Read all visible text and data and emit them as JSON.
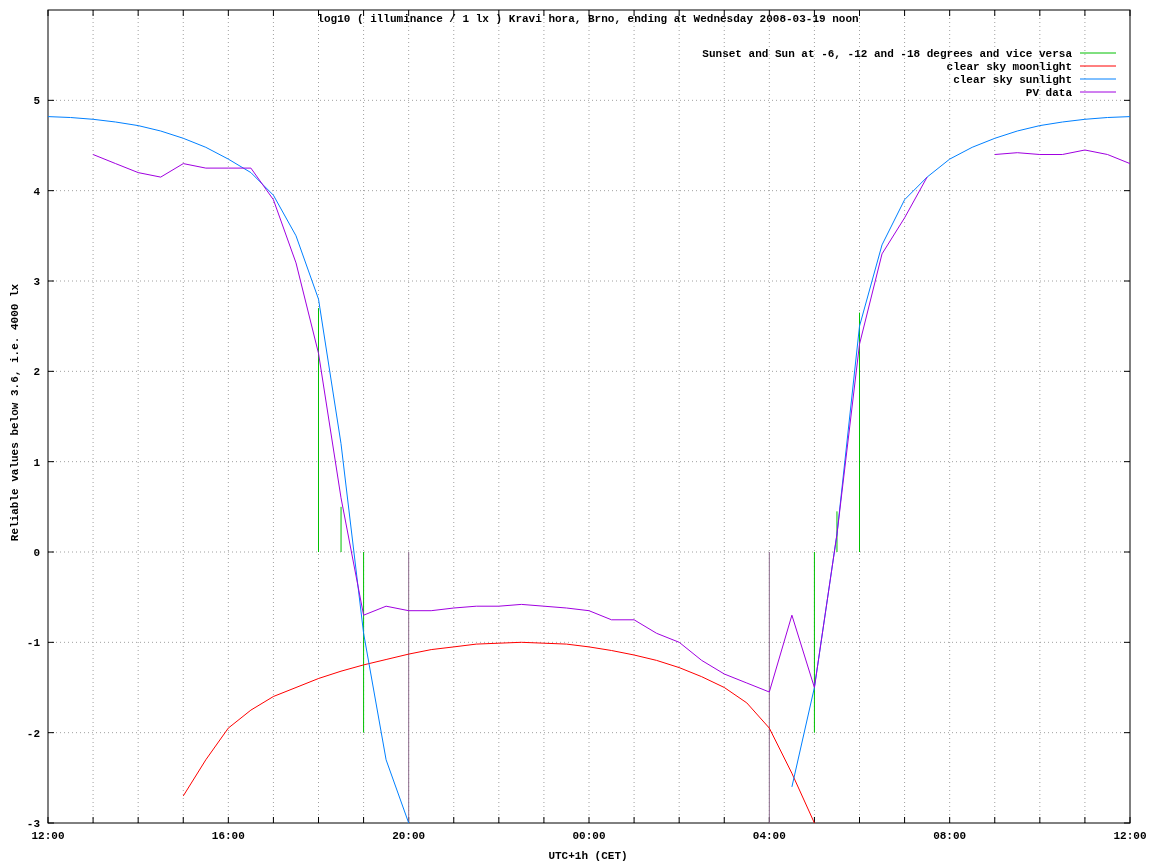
{
  "chart_data": {
    "type": "line",
    "title": "log10 ( illuminance / 1 lx ) Kravi hora, Brno, ending at Wednesday 2008-03-19 noon",
    "xlabel": "UTC+1h (CET)",
    "ylabel": "Reliable values below 3.6, i.e. 4000 lx",
    "ylim": [
      -3,
      6
    ],
    "categories": [
      "12:00",
      null,
      null,
      null,
      null,
      null,
      null,
      null,
      "16:00",
      null,
      null,
      null,
      null,
      null,
      null,
      null,
      "20:00",
      null,
      null,
      null,
      null,
      null,
      null,
      null,
      "00:00",
      null,
      null,
      null,
      null,
      null,
      null,
      null,
      "04:00",
      null,
      null,
      null,
      null,
      null,
      null,
      null,
      "08:00",
      null,
      null,
      null,
      null,
      null,
      null,
      null,
      "12:00"
    ],
    "yticks": [
      -3,
      -2,
      -1,
      0,
      1,
      2,
      3,
      4,
      5
    ],
    "grid": true,
    "legend": "upper right",
    "series": [
      {
        "name": "Sunset and Sun at -6, -12 and -18 degrees and vice versa",
        "color": "#00c000",
        "type": "bar",
        "values": [
          null,
          null,
          null,
          null,
          null,
          null,
          null,
          null,
          null,
          null,
          null,
          null,
          2.7,
          0.5,
          -2.0,
          null,
          null,
          null,
          null,
          null,
          null,
          null,
          null,
          null,
          null,
          null,
          null,
          null,
          null,
          null,
          null,
          null,
          null,
          null,
          -2.0,
          0.45,
          2.65,
          null,
          null,
          null,
          null,
          null,
          null,
          null,
          null,
          null,
          null,
          null,
          null
        ]
      },
      {
        "color": "#8c6c8c",
        "type": "bar",
        "values": [
          null,
          null,
          null,
          null,
          null,
          null,
          null,
          null,
          null,
          null,
          null,
          null,
          null,
          null,
          null,
          null,
          -3.0,
          null,
          null,
          null,
          null,
          null,
          null,
          null,
          null,
          null,
          null,
          null,
          null,
          null,
          null,
          null,
          -3.0,
          null,
          null,
          null,
          null,
          null,
          null,
          null,
          null,
          null,
          null,
          null,
          null,
          null,
          null,
          null,
          null
        ]
      },
      {
        "name": "clear sky moonlight",
        "color": "#ff0000",
        "values": [
          null,
          null,
          null,
          null,
          null,
          null,
          -2.7,
          -2.3,
          -1.95,
          -1.75,
          -1.6,
          -1.5,
          -1.4,
          -1.32,
          -1.25,
          -1.19,
          -1.13,
          -1.08,
          -1.05,
          -1.02,
          -1.01,
          -1.0,
          -1.01,
          -1.02,
          -1.05,
          -1.09,
          -1.14,
          -1.2,
          -1.28,
          -1.38,
          -1.5,
          -1.67,
          -1.95,
          -2.45,
          -3.0,
          null,
          null,
          null,
          null,
          null,
          null,
          null,
          null,
          null,
          null,
          null,
          null,
          null,
          null
        ]
      },
      {
        "name": "clear sky sunlight",
        "color": "#0080ff",
        "values": [
          4.82,
          4.81,
          4.79,
          4.76,
          4.72,
          4.66,
          4.58,
          4.48,
          4.35,
          4.2,
          3.95,
          3.5,
          2.8,
          1.2,
          -0.9,
          -2.3,
          -3.0,
          null,
          null,
          null,
          null,
          null,
          null,
          null,
          null,
          null,
          null,
          null,
          null,
          null,
          null,
          null,
          null,
          -2.6,
          -1.5,
          0.2,
          2.5,
          3.4,
          3.9,
          4.15,
          4.35,
          4.48,
          4.58,
          4.66,
          4.72,
          4.76,
          4.79,
          4.81,
          4.82
        ]
      },
      {
        "name": "PV data",
        "color": "#a000e0",
        "values": [
          null,
          null,
          4.4,
          4.3,
          4.2,
          4.15,
          4.3,
          4.25,
          4.25,
          4.25,
          3.9,
          3.2,
          2.2,
          0.6,
          -0.7,
          -0.6,
          -0.65,
          -0.65,
          -0.62,
          -0.6,
          -0.6,
          -0.58,
          -0.6,
          -0.62,
          -0.65,
          -0.75,
          -0.75,
          -0.9,
          -1.0,
          -1.2,
          -1.35,
          -1.45,
          -1.55,
          -0.7,
          -1.5,
          0.2,
          2.3,
          3.3,
          3.7,
          4.15,
          null,
          null,
          4.4,
          4.42,
          4.4,
          4.4,
          4.45,
          4.4,
          4.3
        ]
      }
    ]
  }
}
